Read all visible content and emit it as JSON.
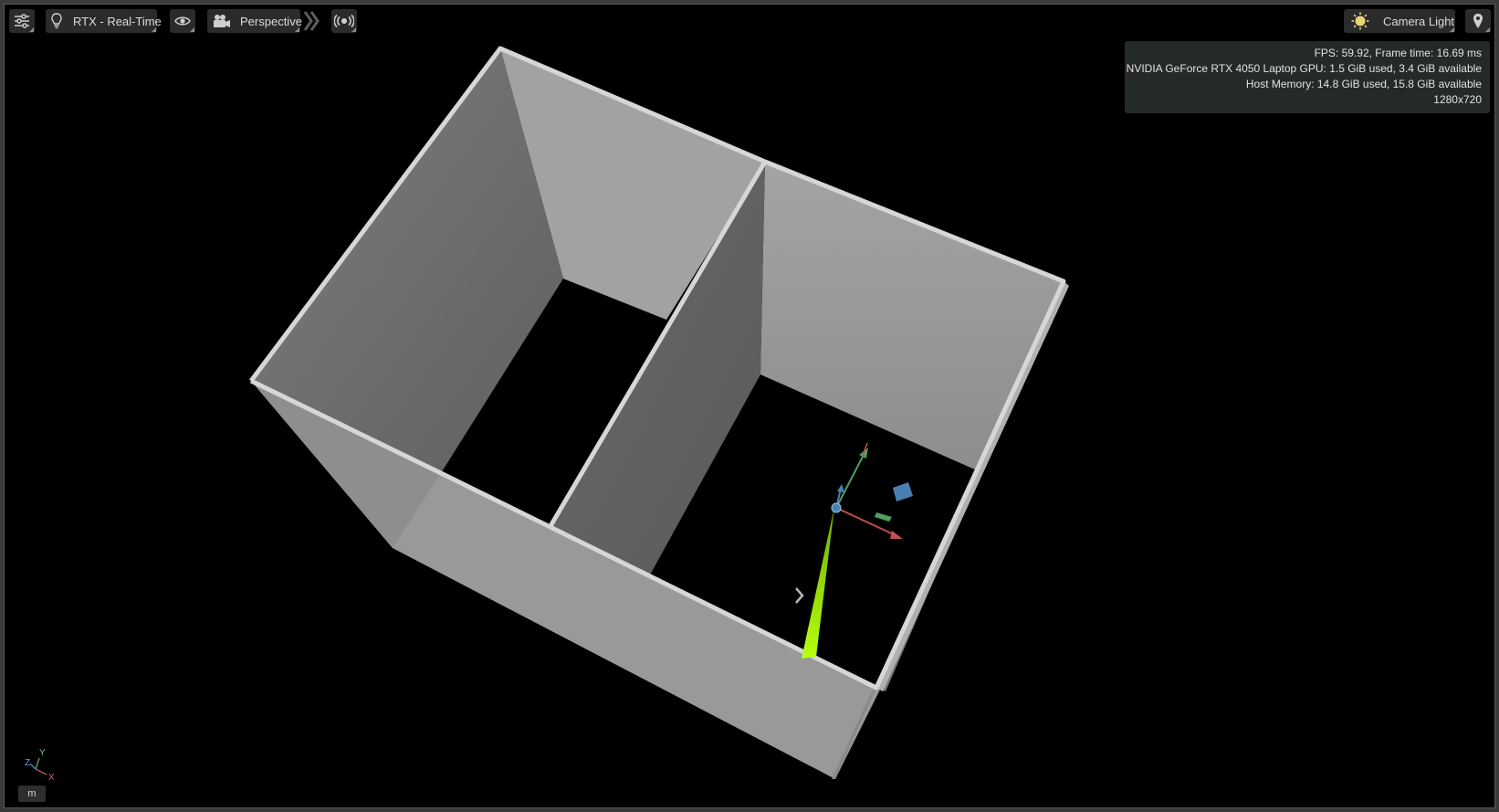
{
  "toolbar": {
    "render_mode_label": "RTX - Real-Time",
    "camera_label": "Perspective",
    "light_label": "Camera Light"
  },
  "stats": {
    "fps_line": "FPS: 59.92, Frame time: 16.69 ms",
    "gpu_line": "NVIDIA GeForce RTX 4050 Laptop GPU: 1.5 GiB used, 3.4 GiB available",
    "host_line": "Host Memory: 14.8 GiB used, 15.8 GiB available",
    "resolution": "1280x720"
  },
  "axis_gizmo": {
    "y": "Y",
    "z": "Z",
    "x": "X"
  },
  "units_button": "m",
  "icons": [
    "settings-sliders-icon",
    "light-bulb-icon",
    "eye-icon",
    "movie-camera-icon",
    "chevron-double-icon",
    "broadcast-icon",
    "sun-icon",
    "location-pin-icon",
    "chevron-right-icon"
  ],
  "colors": {
    "viewport_bg": "#000000",
    "wall_gray": "#9a9a9a",
    "lidar_beam": "#a8f000",
    "axis_x": "#c0504d",
    "axis_y": "#4fa060",
    "axis_z": "#4a7fb5"
  }
}
